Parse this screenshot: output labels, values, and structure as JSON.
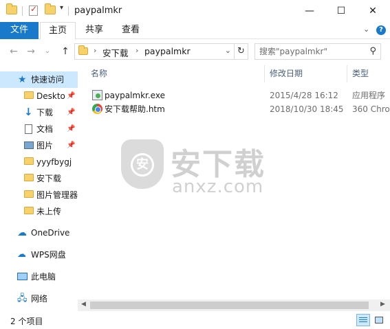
{
  "window": {
    "title": "paypalmkr",
    "controls": {
      "minimize": "—",
      "maximize": "☐",
      "close": "✕"
    }
  },
  "ribbon": {
    "tabs": [
      {
        "label": "文件"
      },
      {
        "label": "主页"
      },
      {
        "label": "共享"
      },
      {
        "label": "查看"
      }
    ],
    "expand_icon": "chevron-down-icon",
    "help_label": "?"
  },
  "address": {
    "crumbs": [
      "安下载",
      "paypalmkr"
    ],
    "refresh_icon": "refresh-icon"
  },
  "search": {
    "placeholder": "搜索\"paypalmkr\""
  },
  "navpane": {
    "quick_access": "快速访问",
    "items": [
      {
        "label": "Deskto",
        "icon": "folder-icon",
        "pinned": true
      },
      {
        "label": "下载",
        "icon": "download-icon",
        "pinned": true
      },
      {
        "label": "文档",
        "icon": "document-icon",
        "pinned": true
      },
      {
        "label": "图片",
        "icon": "pictures-icon",
        "pinned": true
      },
      {
        "label": "yyyfbygj",
        "icon": "folder-icon",
        "pinned": false
      },
      {
        "label": "安下载",
        "icon": "folder-icon",
        "pinned": false
      },
      {
        "label": "图片管理器",
        "icon": "folder-icon",
        "pinned": false
      },
      {
        "label": "未上传",
        "icon": "folder-icon",
        "pinned": false
      }
    ],
    "onedrive": "OneDrive",
    "wps": "WPS网盘",
    "pc": "此电脑",
    "network": "网络"
  },
  "columns": {
    "name": "名称",
    "date": "修改日期",
    "type": "类型"
  },
  "files": [
    {
      "name": "paypalmkr.exe",
      "date": "2015/4/28 16:12",
      "type": "应用程序",
      "icon": "exe-icon"
    },
    {
      "name": "安下载帮助.htm",
      "date": "2018/10/30 18:45",
      "type": "360 Chro",
      "icon": "browser-html-icon"
    }
  ],
  "watermark": {
    "text": "安下载",
    "sub": "anxz.com",
    "shield_char": "安"
  },
  "status": {
    "item_count": "2 个项目"
  },
  "colors": {
    "accent": "#1979ca",
    "selected_bg": "#cce8ff"
  }
}
